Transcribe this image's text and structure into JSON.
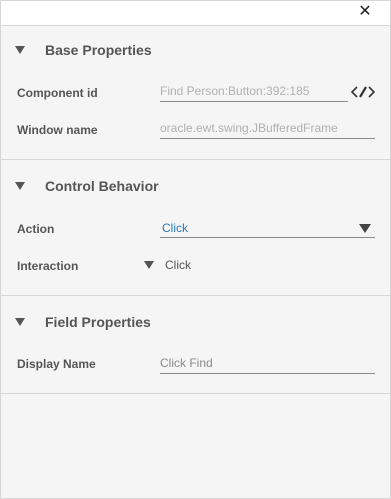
{
  "window": {
    "close_glyph": "✕"
  },
  "sections": {
    "base": {
      "title": "Base Properties",
      "component_id_label": "Component id",
      "component_id_value": "Find Person:Button:392:185",
      "window_name_label": "Window name",
      "window_name_value": "oracle.ewt.swing.JBufferedFrame"
    },
    "control": {
      "title": "Control Behavior",
      "action_label": "Action",
      "action_value": "Click",
      "interaction_label": "Interaction",
      "interaction_value": "Click"
    },
    "field": {
      "title": "Field Properties",
      "display_name_label": "Display Name",
      "display_name_value": "Click Find"
    }
  },
  "colors": {
    "accent_blue": "#2b79b5",
    "divider": "#d6d6d6",
    "background": "#f5f5f5"
  },
  "icons": {
    "close": "close-icon",
    "edit_code": "edit-code-icon",
    "collapse": "triangle-down-icon",
    "dropdown": "chevron-down-icon"
  }
}
